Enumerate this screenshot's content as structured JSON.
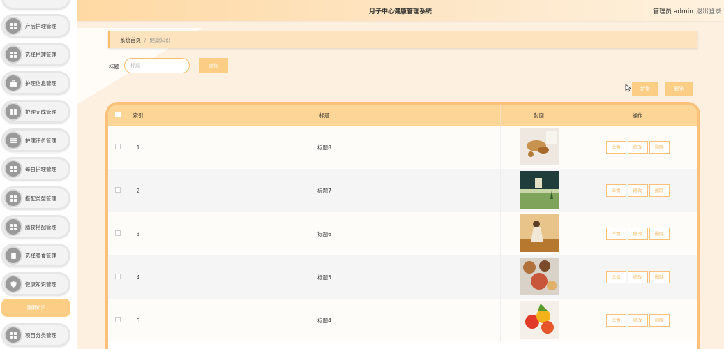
{
  "header": {
    "title": "月子中心健康管理系统",
    "user": "管理员 admin",
    "logout": "退出登录"
  },
  "sidebar": {
    "items": [
      {
        "label": "产后护理管理",
        "icon": "grid-icon"
      },
      {
        "label": "选择护理管理",
        "icon": "grid-icon"
      },
      {
        "label": "护理信息管理",
        "icon": "briefcase-icon"
      },
      {
        "label": "护理完成管理",
        "icon": "grid-icon"
      },
      {
        "label": "护理评价管理",
        "icon": "list-icon"
      },
      {
        "label": "每日护理管理",
        "icon": "grid-icon"
      },
      {
        "label": "搭配类型管理",
        "icon": "grid-icon"
      },
      {
        "label": "膳食搭配管理",
        "icon": "grid-icon"
      },
      {
        "label": "选择膳食管理",
        "icon": "document-icon"
      },
      {
        "label": "健康知识管理",
        "icon": "shield-icon"
      },
      {
        "label": "项目分类管理",
        "icon": "grid-icon"
      }
    ],
    "active_sub": "健康知识"
  },
  "breadcrumb": {
    "home": "系统首页",
    "separator": "/",
    "current": "健康知识"
  },
  "search": {
    "label": "标题",
    "placeholder": "标题",
    "button": "查询"
  },
  "actions": {
    "add": "新增",
    "delete": "删除"
  },
  "table": {
    "headers": [
      "索引",
      "标题",
      "封面",
      "操作"
    ],
    "rows": [
      {
        "index": "1",
        "title": "标题8"
      },
      {
        "index": "2",
        "title": "标题7"
      },
      {
        "index": "3",
        "title": "标题6"
      },
      {
        "index": "4",
        "title": "标题5"
      },
      {
        "index": "5",
        "title": "标题4"
      }
    ],
    "row_actions": {
      "detail": "详情",
      "edit": "修改",
      "delete": "删除"
    }
  },
  "colors": {
    "accent": "#fccd84",
    "accent_border": "#fbbd6a",
    "background": "#fdf0e0"
  }
}
